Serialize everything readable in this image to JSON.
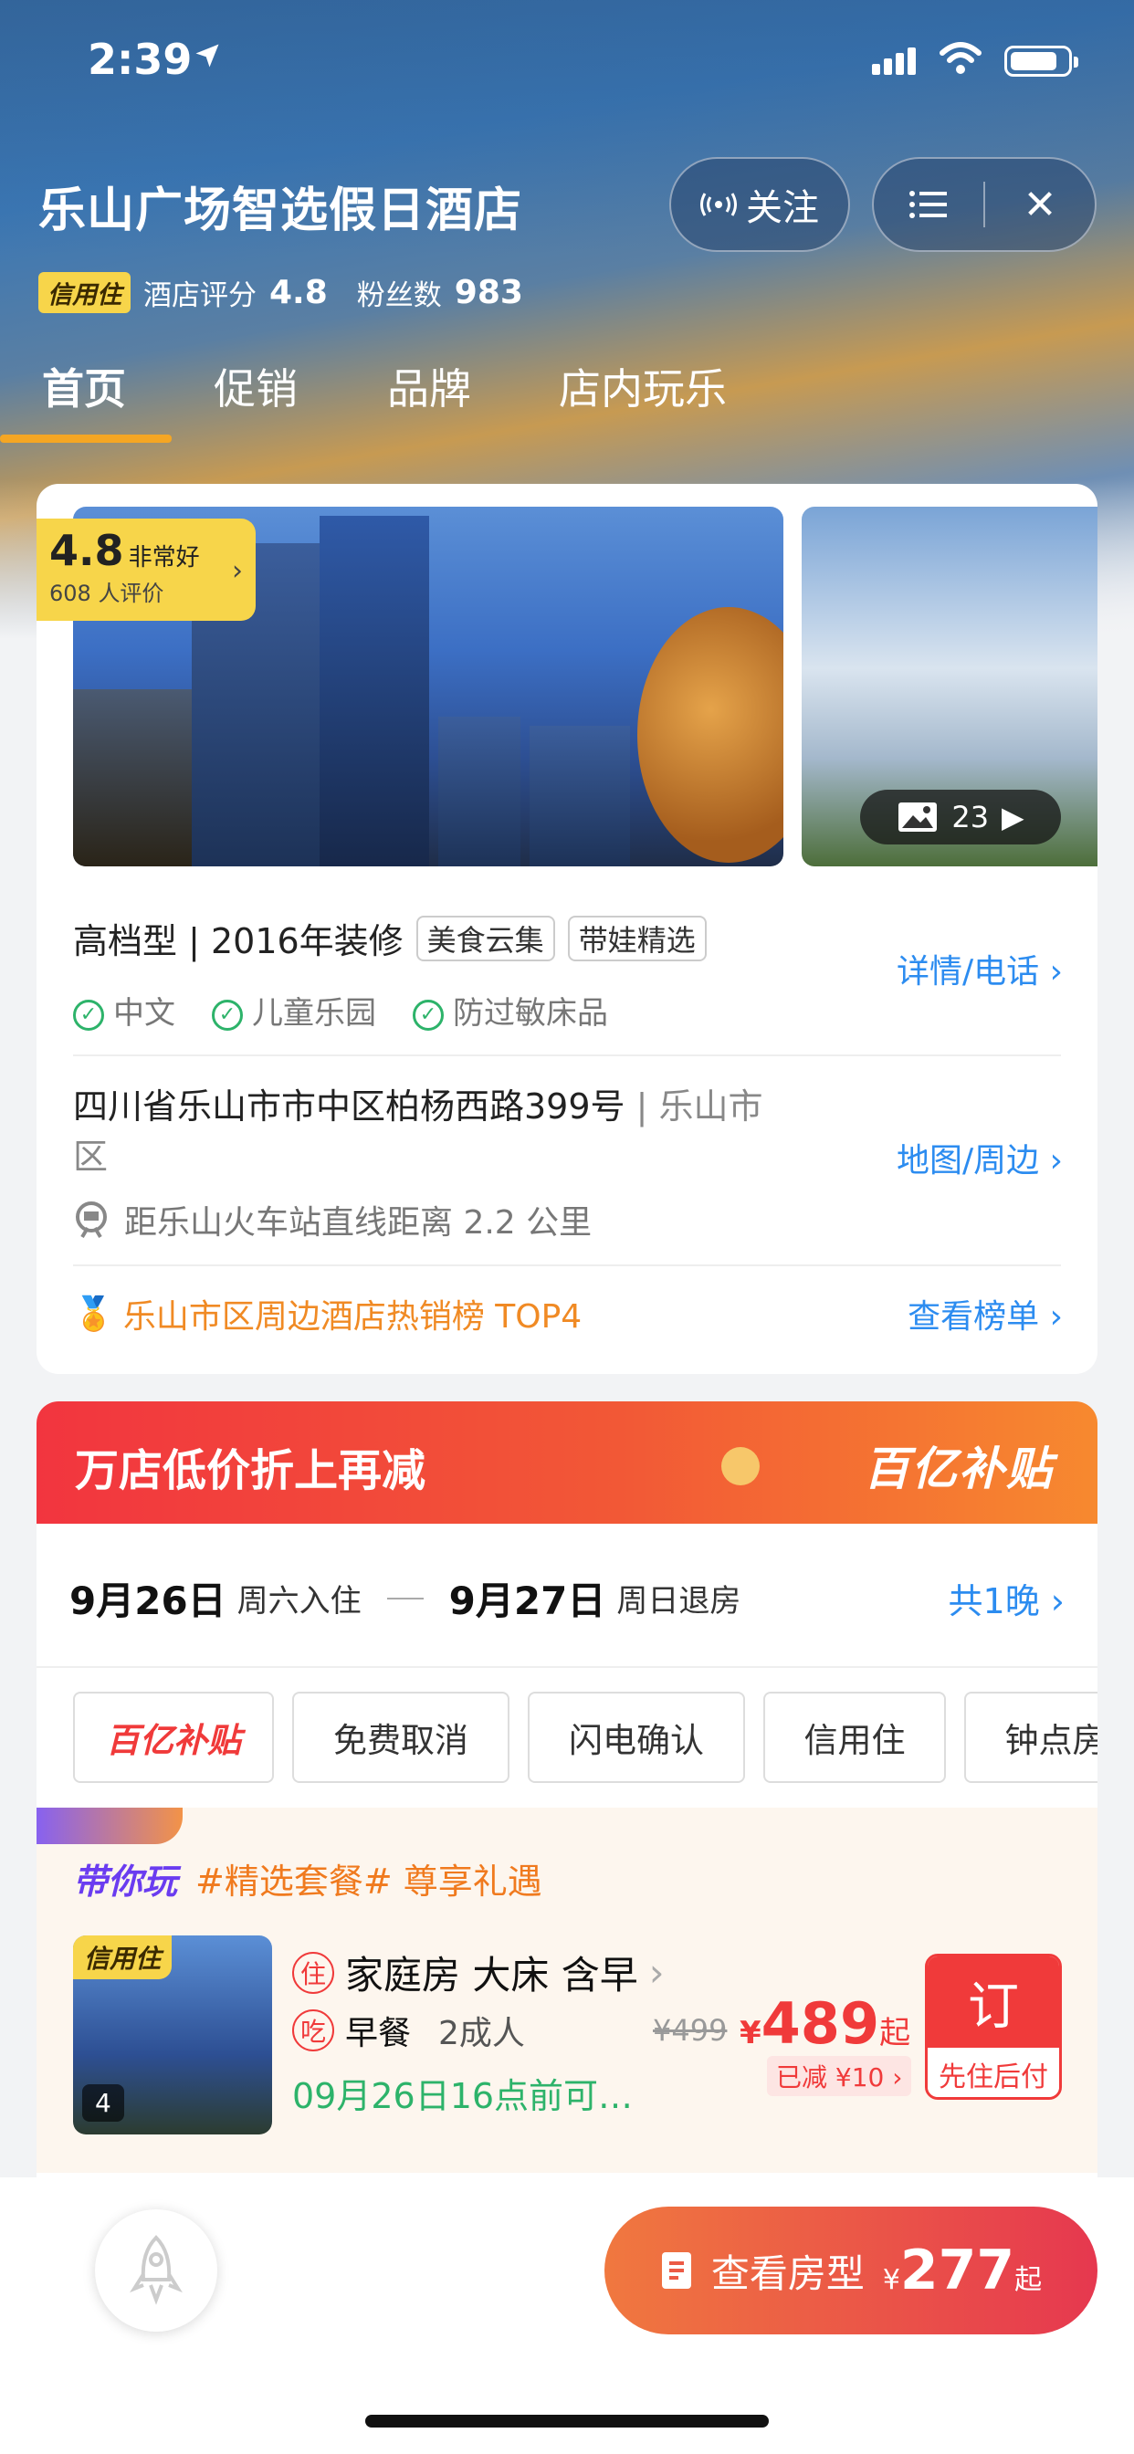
{
  "status_bar": {
    "time": "2:39"
  },
  "header": {
    "hotel_name": "乐山广场智选假日酒店",
    "follow_label": "关注",
    "credit_tag": "信用住",
    "rating_label": "酒店评分",
    "rating": "4.8",
    "fans_label": "粉丝数",
    "fans": "983"
  },
  "tabs": [
    "首页",
    "促销",
    "品牌",
    "店内玩乐"
  ],
  "gallery": {
    "score": "4.8",
    "score_label": "非常好",
    "review_count": "608 人评价",
    "photo_count": "23"
  },
  "info": {
    "grade": "高档型 | 2016年装修",
    "chips": [
      "美食云集",
      "带娃精选"
    ],
    "features": [
      "中文",
      "儿童乐园",
      "防过敏床品"
    ],
    "details_link": "详情/电话",
    "address": "四川省乐山市市中区柏杨西路399号",
    "district": "| 乐山市区",
    "map_link": "地图/周边",
    "distance": "距乐山火车站直线距离 2.2 公里",
    "rank": "乐山市区周边酒店热销榜 TOP4",
    "rank_link": "查看榜单"
  },
  "promo": {
    "banner_text": "万店低价折上再减",
    "banner_logo": "百亿补贴",
    "checkin_date": "9月26日",
    "checkin_label": "周六入住",
    "checkout_date": "9月27日",
    "checkout_label": "周日退房",
    "nights": "共1晚",
    "filters": [
      "百亿补贴",
      "免费取消",
      "闪电确认",
      "信用住",
      "钟点房"
    ]
  },
  "package": {
    "brand": "带你玩",
    "title": "#精选套餐# 尊享礼遇",
    "tag": "信用住",
    "photo_count": "4",
    "room_badge": "住",
    "room_name": "家庭房 大床  含早",
    "meal_badge": "吃",
    "meal": "早餐",
    "guests": "2成人",
    "cancel": "09月26日16点前可…",
    "price_old": "¥499",
    "currency": "¥",
    "price": "489",
    "price_suffix": "起",
    "discount": "已减 ¥10",
    "book_label": "订",
    "book_sub": "先住后付"
  },
  "bottom": {
    "cta_label": "查看房型",
    "cta_currency": "¥",
    "cta_price": "277",
    "cta_suffix": "起"
  }
}
